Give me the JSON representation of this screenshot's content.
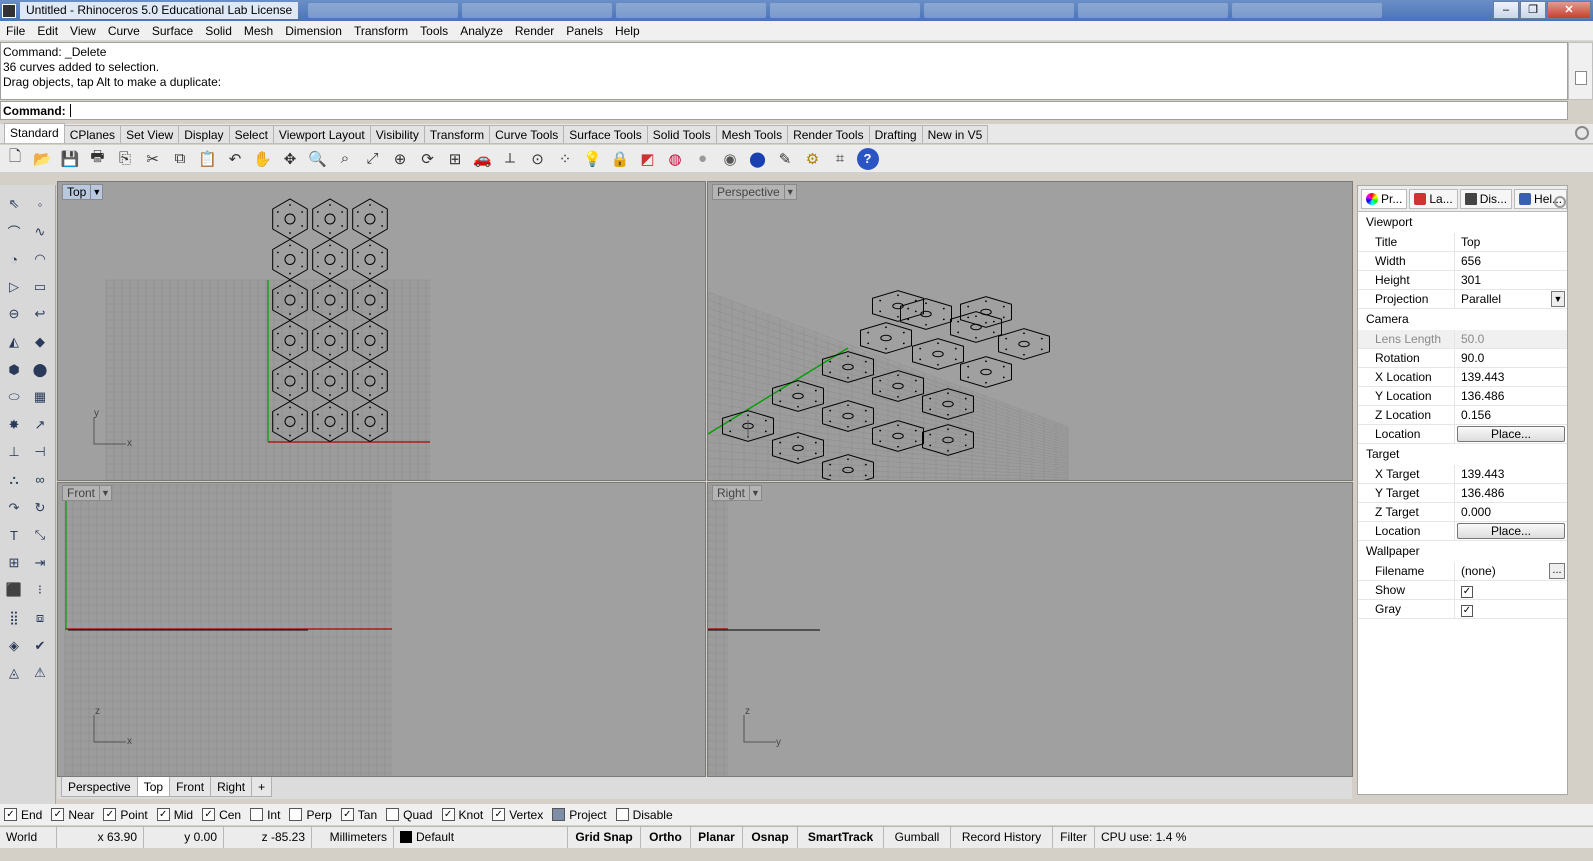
{
  "window": {
    "title": "Untitled - Rhinoceros 5.0 Educational Lab License"
  },
  "menu": [
    "File",
    "Edit",
    "View",
    "Curve",
    "Surface",
    "Solid",
    "Mesh",
    "Dimension",
    "Transform",
    "Tools",
    "Analyze",
    "Render",
    "Panels",
    "Help"
  ],
  "command_history": [
    "Command: _Delete",
    "36 curves added to selection.",
    "Drag objects, tap Alt to make a duplicate:"
  ],
  "command_prompt": "Command:",
  "toolbar_tabs": [
    "Standard",
    "CPlanes",
    "Set View",
    "Display",
    "Select",
    "Viewport Layout",
    "Visibility",
    "Transform",
    "Curve Tools",
    "Surface Tools",
    "Solid Tools",
    "Mesh Tools",
    "Render Tools",
    "Drafting",
    "New in V5"
  ],
  "toolbar_icons": [
    "new-file-icon",
    "open-icon",
    "save-icon",
    "print-icon",
    "import-icon",
    "cut-icon",
    "copy-icon",
    "paste-icon",
    "undo-icon",
    "pan-hand-icon",
    "move-view-icon",
    "zoom-icon",
    "zoom-window-icon",
    "zoom-extents-icon",
    "zoom-selected-icon",
    "rotate-view-icon",
    "four-viewports-icon",
    "car-icon",
    "cplane-icon",
    "grid-snap-icon",
    "point-snap-icon",
    "light-bulb-icon",
    "lock-icon",
    "layer-icon",
    "color-wheel-icon",
    "sphere-white-icon",
    "sphere-gray-icon",
    "sphere-blue-icon",
    "material-icon",
    "gear-icon",
    "history-icon",
    "help-icon"
  ],
  "viewports": {
    "top": "Top",
    "perspective": "Perspective",
    "front": "Front",
    "right": "Right"
  },
  "axes": {
    "top": [
      "y",
      "x"
    ],
    "front": [
      "z",
      "x"
    ],
    "right": [
      "z",
      "y"
    ]
  },
  "viewport_tabs": [
    "Perspective",
    "Top",
    "Front",
    "Right"
  ],
  "panel": {
    "tabs": [
      "Pr...",
      "La...",
      "Dis...",
      "Hel..."
    ],
    "sections": {
      "viewport": "Viewport",
      "camera": "Camera",
      "target": "Target",
      "wallpaper": "Wallpaper"
    },
    "viewport": [
      {
        "k": "Title",
        "v": "Top"
      },
      {
        "k": "Width",
        "v": "656"
      },
      {
        "k": "Height",
        "v": "301"
      },
      {
        "k": "Projection",
        "v": "Parallel"
      }
    ],
    "camera": [
      {
        "k": "Lens Length",
        "v": "50.0"
      },
      {
        "k": "Rotation",
        "v": "90.0"
      },
      {
        "k": "X Location",
        "v": "139.443"
      },
      {
        "k": "Y Location",
        "v": "136.486"
      },
      {
        "k": "Z Location",
        "v": "0.156"
      },
      {
        "k": "Location",
        "v": "Place..."
      }
    ],
    "target": [
      {
        "k": "X Target",
        "v": "139.443"
      },
      {
        "k": "Y Target",
        "v": "136.486"
      },
      {
        "k": "Z Target",
        "v": "0.000"
      },
      {
        "k": "Location",
        "v": "Place..."
      }
    ],
    "wallpaper": [
      {
        "k": "Filename",
        "v": "(none)"
      },
      {
        "k": "Show",
        "v": "✓"
      },
      {
        "k": "Gray",
        "v": "✓"
      }
    ]
  },
  "osnaps": [
    {
      "label": "End",
      "checked": "✓"
    },
    {
      "label": "Near",
      "checked": "✓"
    },
    {
      "label": "Point",
      "checked": "✓"
    },
    {
      "label": "Mid",
      "checked": "✓"
    },
    {
      "label": "Cen",
      "checked": "✓"
    },
    {
      "label": "Int",
      "checked": ""
    },
    {
      "label": "Perp",
      "checked": ""
    },
    {
      "label": "Tan",
      "checked": "✓"
    },
    {
      "label": "Quad",
      "checked": ""
    },
    {
      "label": "Knot",
      "checked": "✓"
    },
    {
      "label": "Vertex",
      "checked": "✓"
    },
    {
      "label": "Project",
      "checked": ""
    },
    {
      "label": "Disable",
      "checked": ""
    }
  ],
  "status": {
    "cplane": "World",
    "x": "x 63.90",
    "y": "y 0.00",
    "z": "z -85.23",
    "units": "Millimeters",
    "layer": "Default",
    "grid_snap": "Grid Snap",
    "ortho": "Ortho",
    "planar": "Planar",
    "osnap": "Osnap",
    "smarttrack": "SmartTrack",
    "gumball": "Gumball",
    "record_history": "Record History",
    "filter": "Filter",
    "cpu": "CPU use: 1.4 %"
  },
  "colors": {
    "viewport_bg": "#a0a0a0",
    "grid": "#8c8c8c",
    "x_axis": "#b00000",
    "y_axis": "#00a000",
    "active_label": "#b9c8de"
  }
}
